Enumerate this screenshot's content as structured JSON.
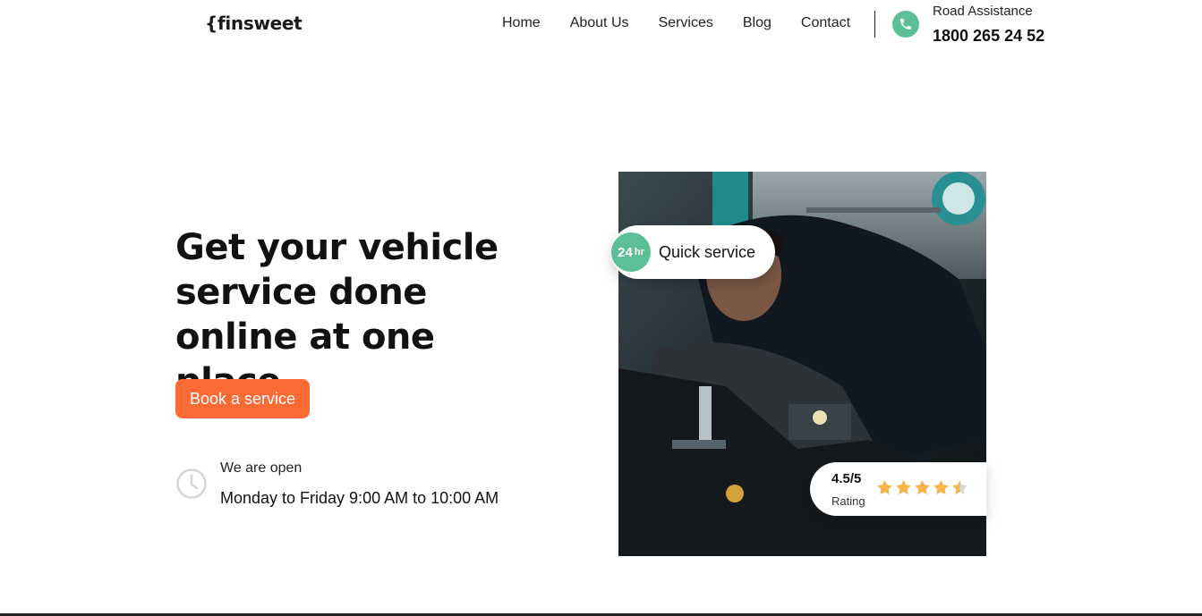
{
  "header": {
    "logo": "{finsweet",
    "nav": [
      "Home",
      "About Us",
      "Services",
      "Blog",
      "Contact"
    ],
    "road_assistance_label": "Road Assistance",
    "road_assistance_phone": "1800 265 24 52",
    "phone_icon": "phone-icon"
  },
  "hero": {
    "title": "Get your vehicle service done online at one place",
    "cta_label": "Book a service",
    "open_label": "We are open",
    "open_hours": "Monday to Friday 9:00 AM to 10:00 AM",
    "clock_icon": "clock-icon"
  },
  "badges": {
    "quick_number": "24",
    "quick_unit": "hr",
    "quick_label": "Quick service",
    "rating_value": "4.5/5",
    "rating_label": "Rating",
    "rating_stars": 4.5,
    "rating_max": 5
  },
  "colors": {
    "accent_green": "#5cbf98",
    "accent_orange": "#fb6a35",
    "star": "#f7b44b"
  }
}
